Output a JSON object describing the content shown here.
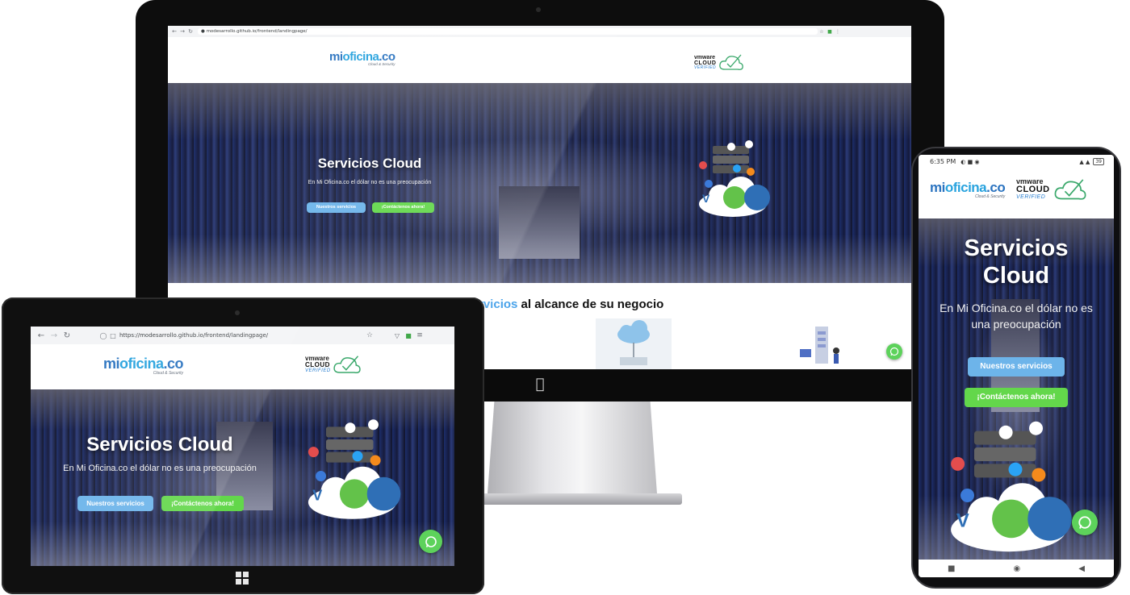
{
  "imac": {
    "url": "modesarrollo.github.io/frontend/landingpage/",
    "hero_title": "Servicios Cloud",
    "hero_subtitle": "En Mi Oficina.co el dólar no es una preocupación",
    "btn_services": "Nuestros servicios",
    "btn_contact": "¡Contáctenos ahora!",
    "section_title_highlight": "rvicios",
    "section_title_rest": " al alcance de su negocio",
    "apple_logo": "apple-icon"
  },
  "tablet": {
    "url": "https://modesarrollo.github.io/frontend/landingpage/",
    "hero_title": "Servicios Cloud",
    "hero_subtitle": "En Mi Oficina.co el dólar no es una preocupación",
    "btn_services": "Nuestros servicios",
    "btn_contact": "¡Contáctenos ahora!"
  },
  "phone": {
    "time": "6:35 PM",
    "battery": "39",
    "hero_title_line1": "Servicios",
    "hero_title_line2": "Cloud",
    "hero_subtitle": "En Mi Oficina.co el dólar no es una preocupación",
    "btn_services": "Nuestros servicios",
    "btn_contact": "¡Contáctenos ahora!"
  },
  "brand": {
    "mi": "mi",
    "oficina": "oficina",
    "co": ".co",
    "tagline": "Cloud & Security"
  },
  "vmware": {
    "vm": "vmware",
    "cloud": "CLOUD",
    "verified": "VERIFIED"
  },
  "colors": {
    "accent_blue": "#6db4ea",
    "accent_green": "#63d74b",
    "whatsapp": "#5dd25b"
  },
  "icons": [
    "back-arrow-icon",
    "forward-arrow-icon",
    "reload-icon",
    "lock-icon",
    "star-icon",
    "shield-icon",
    "menu-icon",
    "whatsapp-icon",
    "windows-logo-icon",
    "apple-icon"
  ]
}
